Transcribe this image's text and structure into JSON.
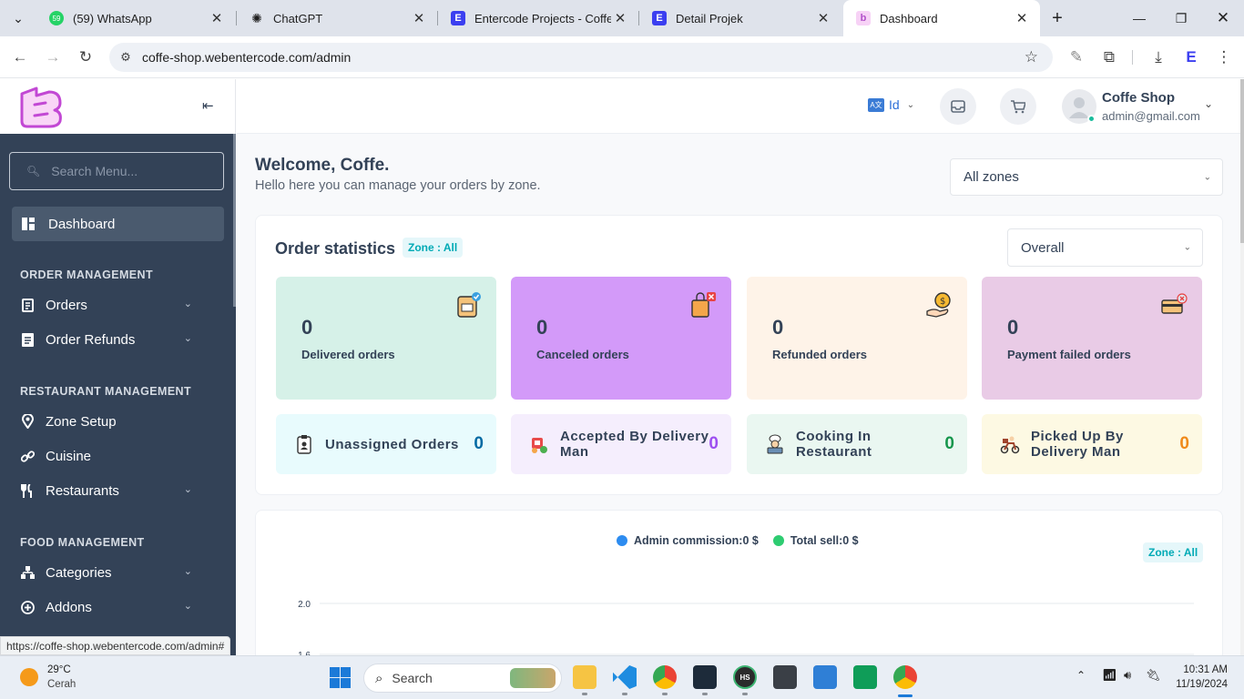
{
  "browser": {
    "tabs": [
      {
        "title": "(59) WhatsApp",
        "fav_color": "#25d366",
        "fav_text": "59"
      },
      {
        "title": "ChatGPT",
        "fav_color": "#ffffff",
        "fav_text": "✺"
      },
      {
        "title": "Entercode Projects - Coffee S",
        "fav_color": "#3b3ff0",
        "fav_text": "E"
      },
      {
        "title": "Detail Projek",
        "fav_color": "#3b3ff0",
        "fav_text": "E"
      },
      {
        "title": "Dashboard",
        "fav_color": "#f7d2f6",
        "fav_text": "b"
      }
    ],
    "new_tab": "+",
    "url": "coffe-shop.webentercode.com/admin",
    "status_url": "https://coffe-shop.webentercode.com/admin#"
  },
  "sidebar": {
    "search_placeholder": "Search Menu...",
    "dashboard_label": "Dashboard",
    "sections": {
      "order": "ORDER MANAGEMENT",
      "restaurant": "RESTAURANT MANAGEMENT",
      "food": "FOOD MANAGEMENT"
    },
    "items": {
      "orders": "Orders",
      "order_refunds": "Order Refunds",
      "zone_setup": "Zone Setup",
      "cuisine": "Cuisine",
      "restaurants": "Restaurants",
      "categories": "Categories",
      "addons": "Addons"
    }
  },
  "header": {
    "language": "Id",
    "user_name": "Coffe Shop",
    "user_email": "admin@gmail.com"
  },
  "welcome": {
    "title": "Welcome, Coffe.",
    "subtitle": "Hello here you can manage your orders by zone.",
    "zone_select": "All zones"
  },
  "order_statistics": {
    "title": "Order statistics",
    "zone_badge": "Zone : All",
    "period_select": "Overall",
    "stats": [
      {
        "value": "0",
        "label": "Delivered orders",
        "bg": "#d6f1e8"
      },
      {
        "value": "0",
        "label": "Canceled orders",
        "bg": "#d39af9"
      },
      {
        "value": "0",
        "label": "Refunded orders",
        "bg": "#fef3e8"
      },
      {
        "value": "0",
        "label": "Payment failed orders",
        "bg": "#e9cbe6"
      }
    ],
    "mini": [
      {
        "label": "Unassigned Orders",
        "value": "0",
        "bg": "#e8fbfd",
        "color": "#006aa3"
      },
      {
        "label": "Accepted By Delivery Man",
        "value": "0",
        "bg": "#f5eefd",
        "color": "#9d4ff0"
      },
      {
        "label": "Cooking In Restaurant",
        "value": "0",
        "bg": "#eaf7f1",
        "color": "#16964c"
      },
      {
        "label": "Picked Up By Delivery Man",
        "value": "0",
        "bg": "#fdf9e3",
        "color": "#f08a1a"
      }
    ]
  },
  "earnings_chart": {
    "legend_admin": "Admin commission:0 $",
    "legend_total": "Total sell:0 $",
    "zone_badge": "Zone : All",
    "colors": {
      "admin": "#2d8cf0",
      "total": "#2ecc71"
    }
  },
  "chart_data": {
    "type": "line",
    "series": [
      {
        "name": "Admin commission",
        "values": []
      },
      {
        "name": "Total sell",
        "values": []
      }
    ],
    "y_ticks": [
      "2.0",
      "1.6"
    ],
    "ylim": [
      0,
      2.0
    ]
  },
  "taskbar": {
    "weather_temp": "29°C",
    "weather_desc": "Cerah",
    "search": "Search",
    "time": "10:31 AM",
    "date": "11/19/2024"
  }
}
